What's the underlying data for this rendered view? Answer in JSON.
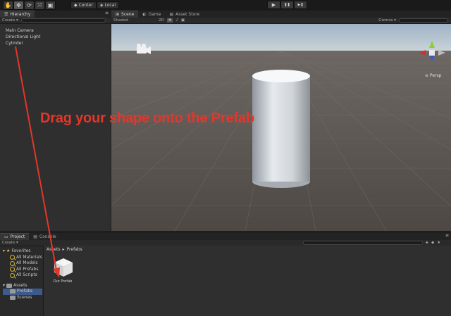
{
  "toolbar": {
    "tools": [
      "hand-tool",
      "move-tool",
      "rotate-tool",
      "scale-tool",
      "rect-tool"
    ],
    "pivot_label": "Center",
    "space_label": "Local",
    "play_icon": "▶",
    "pause_icon": "❚❚",
    "step_icon": "▶❚"
  },
  "hierarchy": {
    "tab_label": "Hierarchy",
    "create_label": "Create ▾",
    "items": [
      "Main Camera",
      "Directional Light",
      "Cylinder"
    ]
  },
  "scene": {
    "tabs": [
      "Scene",
      "Game",
      "Asset Store"
    ],
    "shading_label": "Shaded",
    "mode_2d": "2D",
    "gizmos_label": "Gizmos ▾",
    "persp_label": "≡ Persp"
  },
  "annotation": {
    "text": "Drag your shape onto the Prefab",
    "color": "#e2372a"
  },
  "project": {
    "tabs": [
      "Project",
      "Console"
    ],
    "create_label": "Create ▾",
    "favorites_label": "Favorites",
    "favorites": [
      "All Materials",
      "All Models",
      "All Prefabs",
      "All Scripts"
    ],
    "assets_label": "Assets",
    "asset_folders": [
      "Prefabs",
      "Scenes"
    ],
    "breadcrumb": [
      "Assets",
      "Prefabs"
    ],
    "prefab_name": "Our Prefab"
  }
}
